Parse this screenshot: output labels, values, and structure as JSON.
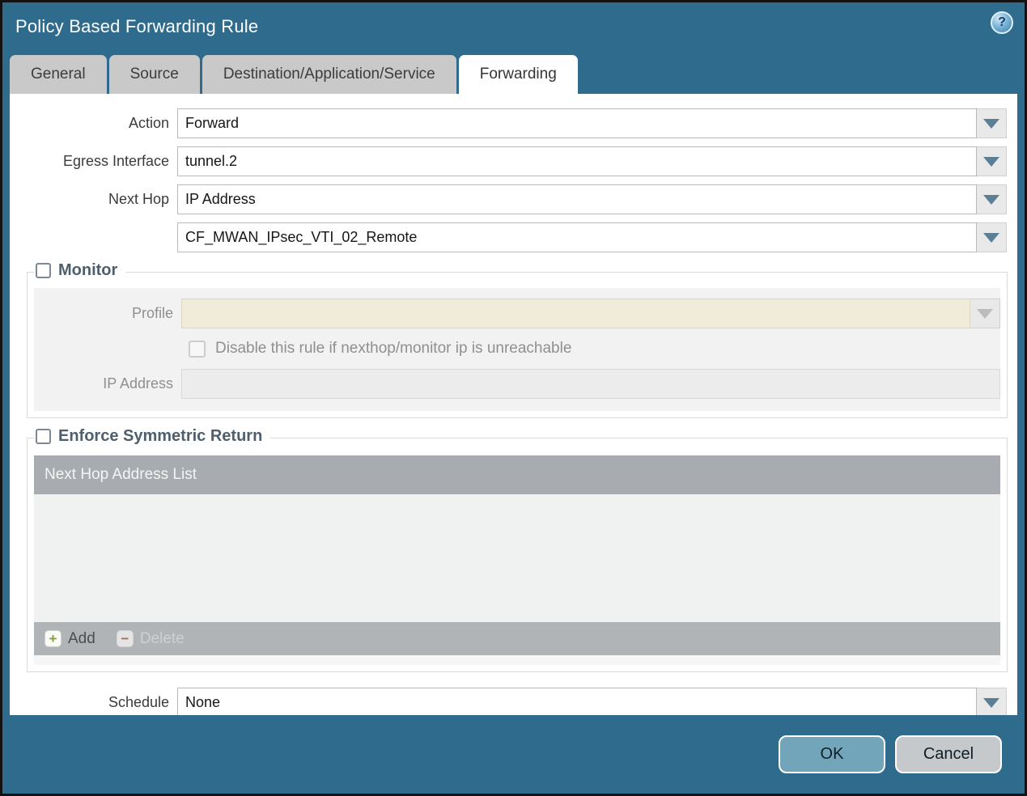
{
  "dialog": {
    "title": "Policy Based Forwarding Rule"
  },
  "tabs": [
    {
      "label": "General"
    },
    {
      "label": "Source"
    },
    {
      "label": "Destination/Application/Service"
    },
    {
      "label": "Forwarding"
    }
  ],
  "form": {
    "action": {
      "label": "Action",
      "value": "Forward"
    },
    "egress_interface": {
      "label": "Egress Interface",
      "value": "tunnel.2"
    },
    "next_hop": {
      "label": "Next Hop",
      "value": "IP Address"
    },
    "next_hop_address": {
      "value": "CF_MWAN_IPsec_VTI_02_Remote"
    },
    "schedule": {
      "label": "Schedule",
      "value": "None"
    }
  },
  "monitor": {
    "legend": "Monitor",
    "checked": false,
    "profile": {
      "label": "Profile",
      "value": ""
    },
    "disable_rule_label": "Disable this rule if nexthop/monitor ip is unreachable",
    "ip_address": {
      "label": "IP Address",
      "value": ""
    }
  },
  "enforce_symmetric_return": {
    "legend": "Enforce Symmetric Return",
    "checked": false,
    "table": {
      "header": "Next Hop Address List",
      "rows": []
    },
    "add_label": "Add",
    "delete_label": "Delete"
  },
  "footer": {
    "ok_label": "OK",
    "cancel_label": "Cancel"
  },
  "icons": {
    "help": "?",
    "add_plus": "+",
    "delete_minus": "−"
  },
  "colors": {
    "chrome_teal": "#2e6b8d",
    "tab_inactive": "#c9c9c9",
    "arrow_blue_gray": "#5b7f95",
    "disabled_cream": "#f1ebd9",
    "table_header_gray": "#a8acb0",
    "ok_button": "#72a5ba",
    "cancel_button": "#c6c9cb"
  }
}
